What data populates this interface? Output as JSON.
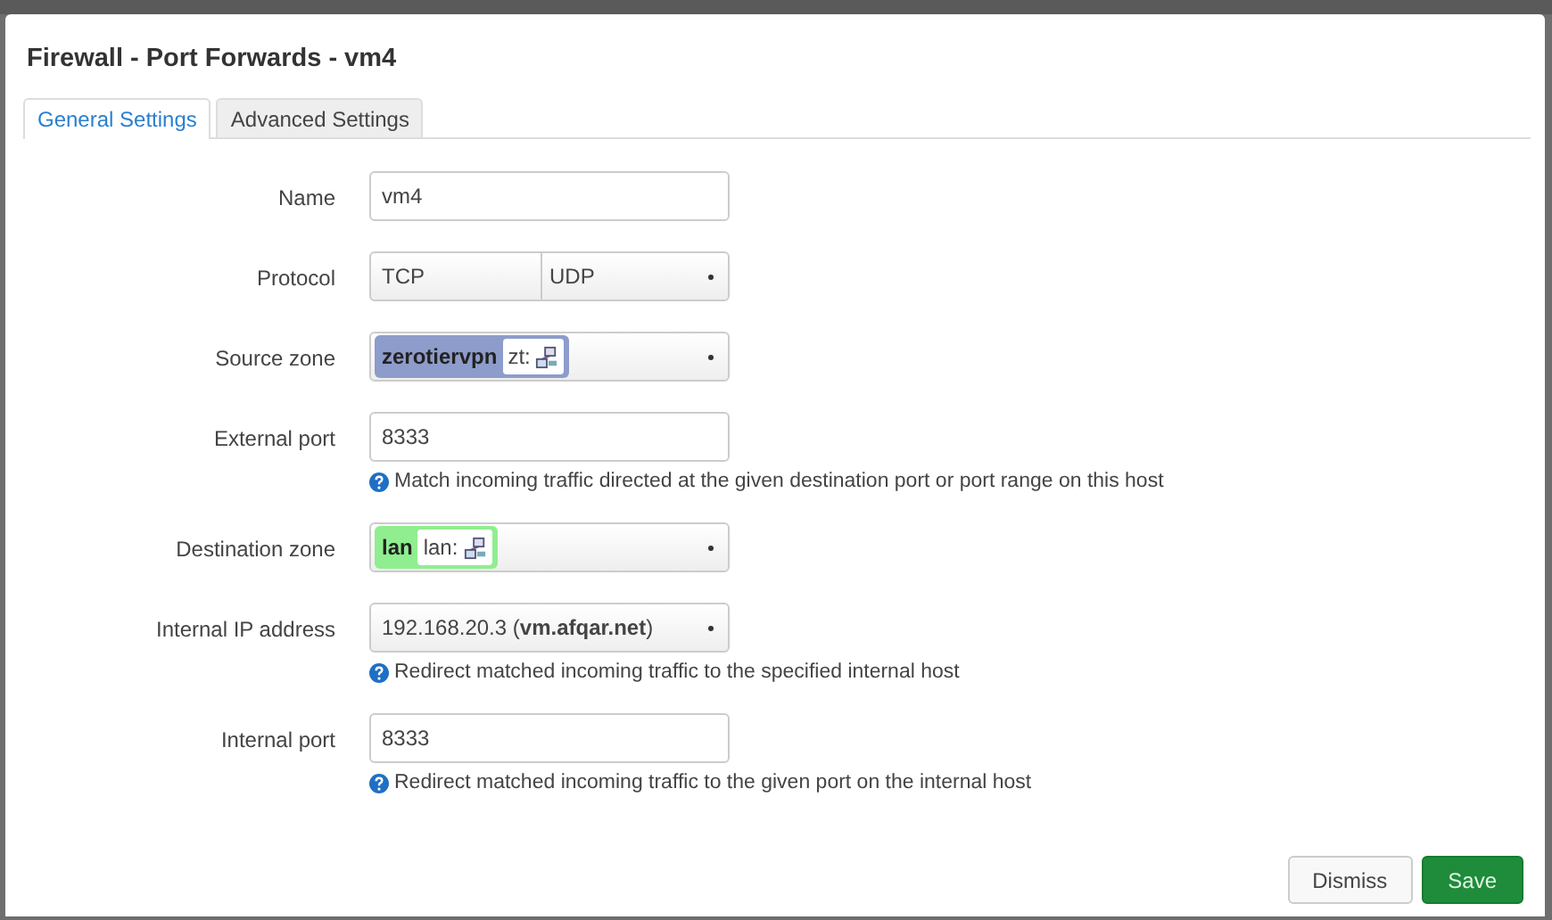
{
  "dialog": {
    "title": "Firewall - Port Forwards - vm4"
  },
  "tabs": [
    {
      "label": "General Settings",
      "selected": true
    },
    {
      "label": "Advanced Settings",
      "selected": false
    }
  ],
  "fields": [
    {
      "kind": "text",
      "label": "Name",
      "value": "vm4"
    },
    {
      "kind": "multiselect",
      "label": "Protocol",
      "options": [
        "TCP",
        "UDP"
      ]
    },
    {
      "kind": "zone",
      "label": "Source zone",
      "zone": "zerotiervpn",
      "alias": "zt:",
      "color": "#8e9ccb"
    },
    {
      "kind": "text",
      "label": "External port",
      "value": "8333",
      "help": "Match incoming traffic directed at the given destination port or port range on this host"
    },
    {
      "kind": "zone",
      "label": "Destination zone",
      "zone": "lan",
      "alias": "lan:",
      "color": "#90ee90"
    },
    {
      "kind": "select",
      "label": "Internal IP address",
      "value": "192.168.20.3 (**vm.afqar.net**)",
      "help": "Redirect matched incoming traffic to the specified internal host"
    },
    {
      "kind": "text",
      "label": "Internal port",
      "value": "8333",
      "help": "Redirect matched incoming traffic to the given port on the internal host"
    }
  ],
  "buttons": [
    {
      "label": "Dismiss",
      "kind": "neutral"
    },
    {
      "label": "Save",
      "kind": "primary"
    }
  ]
}
